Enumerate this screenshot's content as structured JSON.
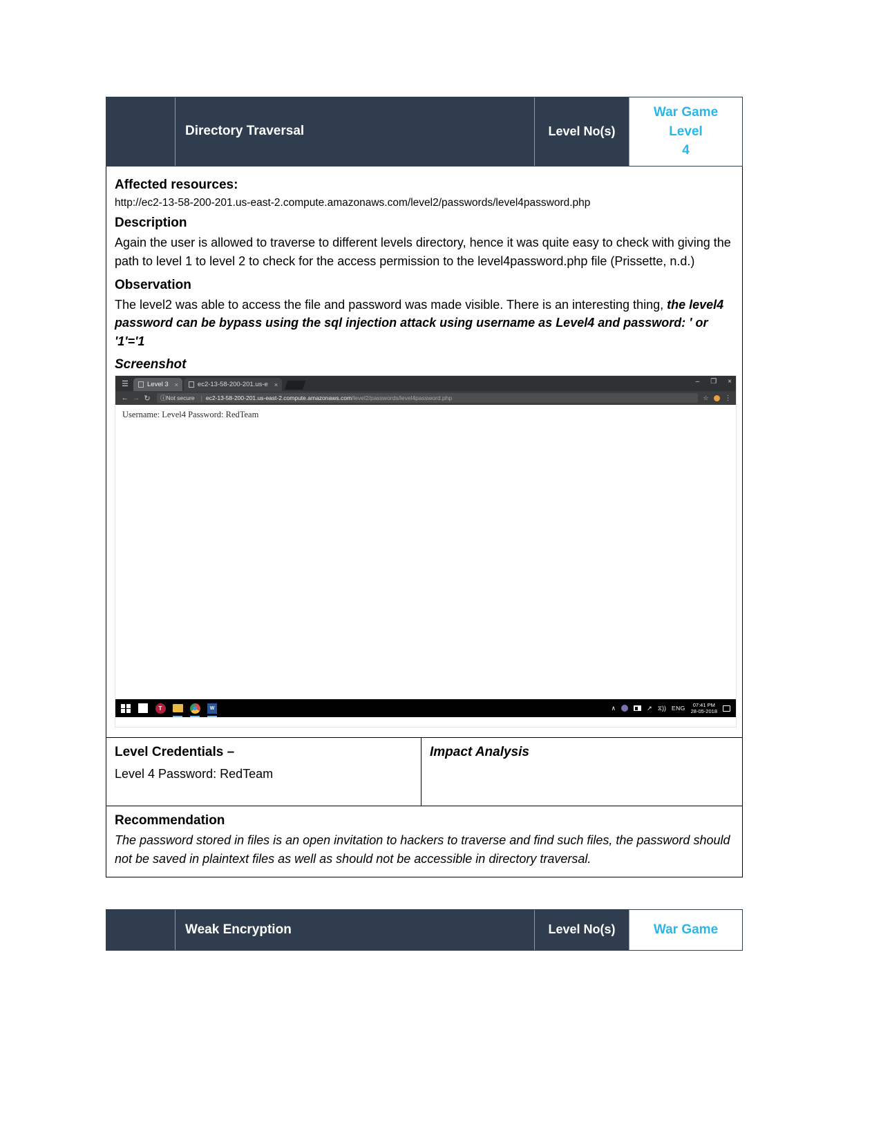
{
  "vuln1": {
    "title": "Directory Traversal",
    "level_no_label": "Level No(s)",
    "war_game_line1": "War Game",
    "war_game_line2": "Level",
    "war_game_line3": "4",
    "affected_heading": "Affected resources:",
    "affected_url": "http://ec2-13-58-200-201.us-east-2.compute.amazonaws.com/level2/passwords/level4password.php",
    "description_heading": "Description",
    "description_text": "Again the user is allowed to traverse to different levels directory, hence it was quite easy to check with giving the path to level 1 to level 2 to check for the access permission to the level4password.php file (Prissette, n.d.)",
    "observation_heading": "Observation",
    "observation_plain": "The level2 was able to access the file and password was made visible. There is an interesting thing, ",
    "observation_bold": "the level4 password can be bypass using the sql injection attack using username as Level4 and password: ' or '1'='1",
    "screenshot_heading": "Screenshot",
    "credentials_heading": "Level Credentials –",
    "credentials_value": "Level 4 Password: RedTeam",
    "impact_heading": "Impact Analysis",
    "impact_value": "",
    "recommendation_heading": "Recommendation",
    "recommendation_text": "The password stored in files is an open invitation to hackers to traverse and find such files, the password should not be saved in plaintext files as well as should not be accessible in directory traversal."
  },
  "browser": {
    "tab1_label": "Level 3",
    "tab2_label": "ec2-13-58-200-201.us-e",
    "tab_close": "×",
    "minimize": "–",
    "maximize": "❐",
    "close": "×",
    "back": "←",
    "forward": "→",
    "reload": "↻",
    "security_label": "Not secure",
    "security_icon": "ⓘ",
    "url_host": "ec2-13-58-200-201.us-east-2.compute.amazonaws.com",
    "url_path": "/level2/passwords/level4password.php",
    "star": "☆",
    "menu": "⋮",
    "page_text": "Username: Level4 Password: RedTeam"
  },
  "taskbar": {
    "tray_up": "∧",
    "language": "ENG",
    "clock_time": "07:41 PM",
    "clock_date": "28-05-2018",
    "teams_letter": "T",
    "word_letter": "W",
    "volume": "⧖))"
  },
  "vuln2": {
    "title": "Weak Encryption",
    "level_no_label": "Level No(s)",
    "war_game": "War Game"
  }
}
